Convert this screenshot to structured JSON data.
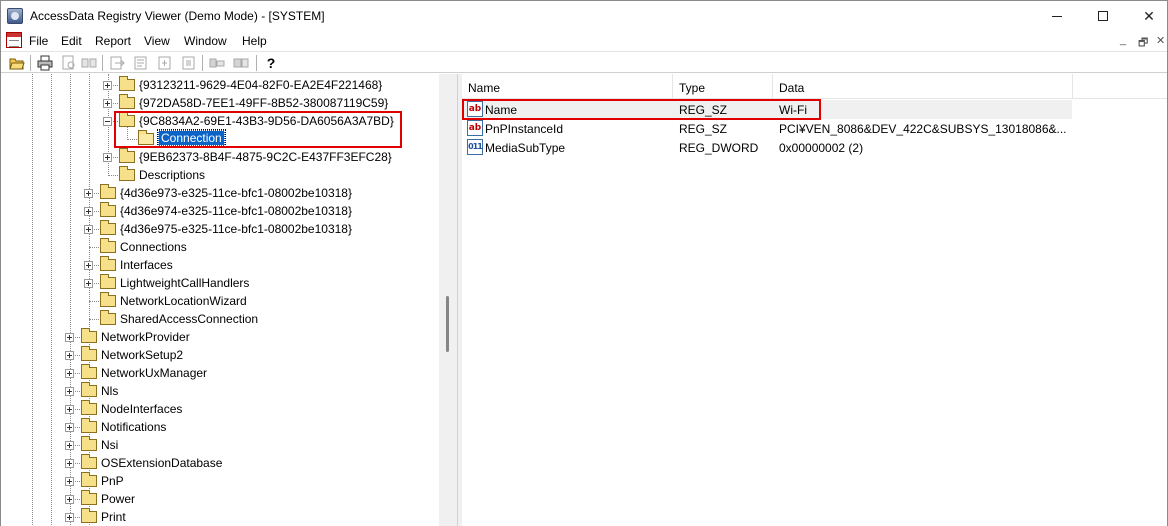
{
  "window": {
    "title": "AccessData Registry Viewer (Demo Mode) - [SYSTEM]",
    "minimize": "—",
    "maximize": "☐",
    "close": "✕"
  },
  "menu": {
    "items": [
      "File",
      "Edit",
      "Report",
      "View",
      "Window",
      "Help"
    ],
    "mdi_min": "_",
    "mdi_restore": "🗗",
    "mdi_close": "✕"
  },
  "toolbar": {
    "help": "?"
  },
  "tree": {
    "items": [
      {
        "label": "{93123211-9629-4E04-82F0-EA2E4F221468}",
        "level": 3,
        "expander": "plus"
      },
      {
        "label": "{972DA58D-7EE1-49FF-8B52-380087119C59}",
        "level": 3,
        "expander": "plus"
      },
      {
        "label": "{9C8834A2-69E1-43B3-9D56-DA6056A3A7BD}",
        "level": 3,
        "expander": "minus"
      },
      {
        "label": "Connection",
        "level": 4,
        "expander": "none",
        "selected": true
      },
      {
        "label": "{9EB62373-8B4F-4875-9C2C-E437FF3EFC28}",
        "level": 3,
        "expander": "plus"
      },
      {
        "label": "Descriptions",
        "level": 3,
        "expander": "none"
      },
      {
        "label": "{4d36e973-e325-11ce-bfc1-08002be10318}",
        "level": 2,
        "expander": "plus"
      },
      {
        "label": "{4d36e974-e325-11ce-bfc1-08002be10318}",
        "level": 2,
        "expander": "plus"
      },
      {
        "label": "{4d36e975-e325-11ce-bfc1-08002be10318}",
        "level": 2,
        "expander": "plus"
      },
      {
        "label": "Connections",
        "level": 2,
        "expander": "none"
      },
      {
        "label": "Interfaces",
        "level": 2,
        "expander": "plus"
      },
      {
        "label": "LightweightCallHandlers",
        "level": 2,
        "expander": "plus"
      },
      {
        "label": "NetworkLocationWizard",
        "level": 2,
        "expander": "none"
      },
      {
        "label": "SharedAccessConnection",
        "level": 2,
        "expander": "none"
      },
      {
        "label": "NetworkProvider",
        "level": 1,
        "expander": "plus"
      },
      {
        "label": "NetworkSetup2",
        "level": 1,
        "expander": "plus"
      },
      {
        "label": "NetworkUxManager",
        "level": 1,
        "expander": "plus"
      },
      {
        "label": "Nls",
        "level": 1,
        "expander": "plus"
      },
      {
        "label": "NodeInterfaces",
        "level": 1,
        "expander": "plus"
      },
      {
        "label": "Notifications",
        "level": 1,
        "expander": "plus"
      },
      {
        "label": "Nsi",
        "level": 1,
        "expander": "plus"
      },
      {
        "label": "OSExtensionDatabase",
        "level": 1,
        "expander": "plus"
      },
      {
        "label": "PnP",
        "level": 1,
        "expander": "plus"
      },
      {
        "label": "Power",
        "level": 1,
        "expander": "plus"
      },
      {
        "label": "Print",
        "level": 1,
        "expander": "plus"
      }
    ]
  },
  "list": {
    "columns": [
      "Name",
      "Type",
      "Data"
    ],
    "rows": [
      {
        "icon": "ab",
        "name": "Name",
        "type": "REG_SZ",
        "data": "Wi-Fi"
      },
      {
        "icon": "ab",
        "name": "PnPInstanceId",
        "type": "REG_SZ",
        "data": "PCI¥VEN_8086&DEV_422C&SUBSYS_13018086&..."
      },
      {
        "icon": "011",
        "name": "MediaSubType",
        "type": "REG_DWORD",
        "data": "0x00000002 (2)"
      }
    ]
  },
  "colors": {
    "highlight_box": "#e00000",
    "selection": "#0a64c8"
  }
}
